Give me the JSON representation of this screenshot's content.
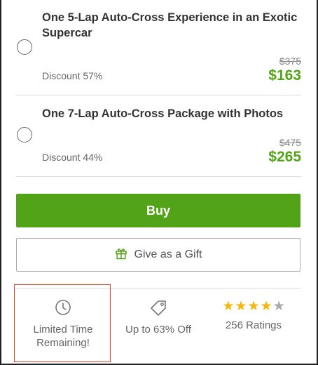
{
  "options": [
    {
      "title": "One 5-Lap Auto-Cross Experience in an Exotic Supercar",
      "discount": "Discount 57%",
      "original_price": "$375",
      "price": "$163"
    },
    {
      "title": "One 7-Lap Auto-Cross Package with Photos",
      "discount": "Discount 44%",
      "original_price": "$475",
      "price": "$265"
    }
  ],
  "actions": {
    "buy_label": "Buy",
    "gift_label": "Give as a Gift",
    "gift_icon": "gift-icon"
  },
  "features": {
    "limited_time": {
      "icon": "clock-icon",
      "line1": "Limited Time",
      "line2": "Remaining!"
    },
    "discount": {
      "icon": "tag-icon",
      "label": "Up to 63% Off"
    },
    "ratings": {
      "label": "256 Ratings",
      "stars": 4,
      "max_stars": 5
    }
  },
  "colors": {
    "accent_green": "#53a318",
    "star_gold": "#f5b50a",
    "star_gray": "#aaaaaa",
    "highlight_red": "#e0442b"
  }
}
